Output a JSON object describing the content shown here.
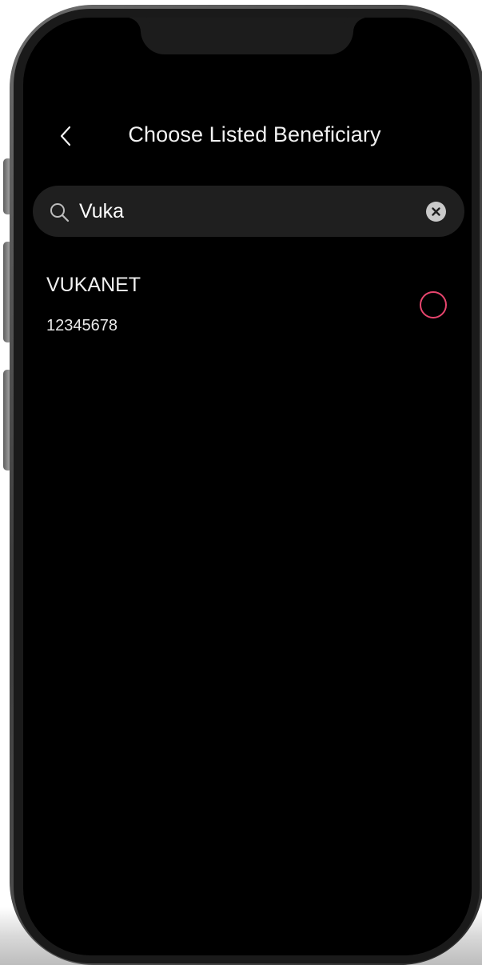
{
  "header": {
    "title": "Choose Listed Beneficiary",
    "back_icon": "chevron-left-icon"
  },
  "search": {
    "value": "Vuka",
    "placeholder": "",
    "icon": "search-icon",
    "clear_icon": "clear-circle-icon"
  },
  "beneficiaries": [
    {
      "name": "VUKANET",
      "account": "12345678",
      "selected": false
    }
  ],
  "colors": {
    "background": "#000000",
    "search_bg": "#1f1f1f",
    "text": "#f0f0f0",
    "accent": "#e8456e"
  }
}
